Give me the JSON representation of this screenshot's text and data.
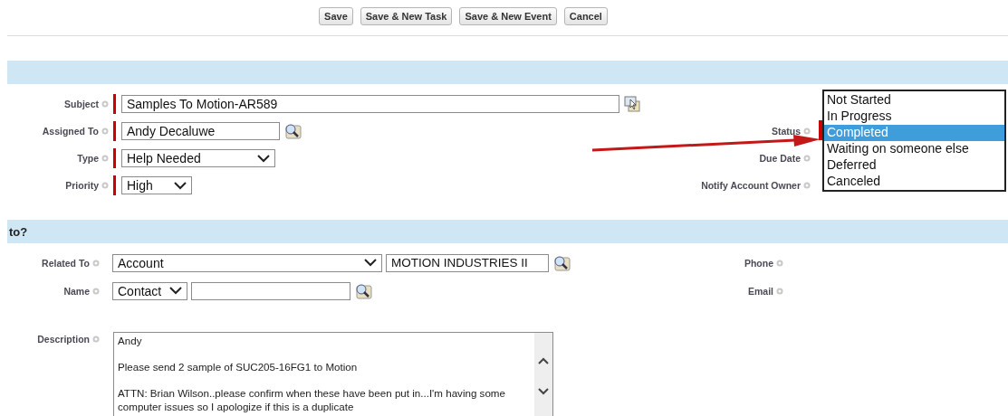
{
  "buttons": [
    {
      "label": "Save"
    },
    {
      "label": "Save & New Task"
    },
    {
      "label": "Save & New Event"
    },
    {
      "label": "Cancel"
    }
  ],
  "task_section": {
    "rows": [
      {
        "left": {
          "label": "Subject",
          "kind": "combo",
          "value": "Samples To Motion-AR589",
          "required": true
        },
        "right": null
      },
      {
        "left": {
          "label": "Assigned To",
          "kind": "lookup",
          "value": "Andy Decaluwe",
          "required": true
        },
        "right": {
          "label": "Status"
        }
      },
      {
        "left": {
          "label": "Type",
          "kind": "select",
          "value": "Help Needed",
          "required": true
        },
        "right": {
          "label": "Due Date"
        }
      },
      {
        "left": {
          "label": "Priority",
          "kind": "select",
          "value": "High",
          "required": true
        },
        "right": {
          "label": "Notify Account Owner"
        }
      }
    ],
    "status_options": [
      {
        "label": "Not Started",
        "selected": false
      },
      {
        "label": "In Progress",
        "selected": false
      },
      {
        "label": "Completed",
        "selected": true
      },
      {
        "label": "Waiting on someone else",
        "selected": false
      },
      {
        "label": "Deferred",
        "selected": false
      },
      {
        "label": "Canceled",
        "selected": false
      }
    ]
  },
  "related_section": {
    "title": "to?",
    "rows": [
      {
        "left": {
          "label": "Related To",
          "kind": "select-lookup",
          "select": "Account",
          "value": "MOTION INDUSTRIES II"
        },
        "right": {
          "label": "Phone"
        }
      },
      {
        "left": {
          "label": "Name",
          "kind": "select-lookup",
          "select": "Contact"
        },
        "right": {
          "label": "Email"
        }
      }
    ],
    "description": {
      "label": "Description",
      "value": "Andy\n\nPlease send 2 sample of SUC205-16FG1 to Motion\n\nATTN: Brian Wilson..please confirm when these have been put in...I'm having some computer issues so I apologize if this is a duplicate"
    }
  }
}
